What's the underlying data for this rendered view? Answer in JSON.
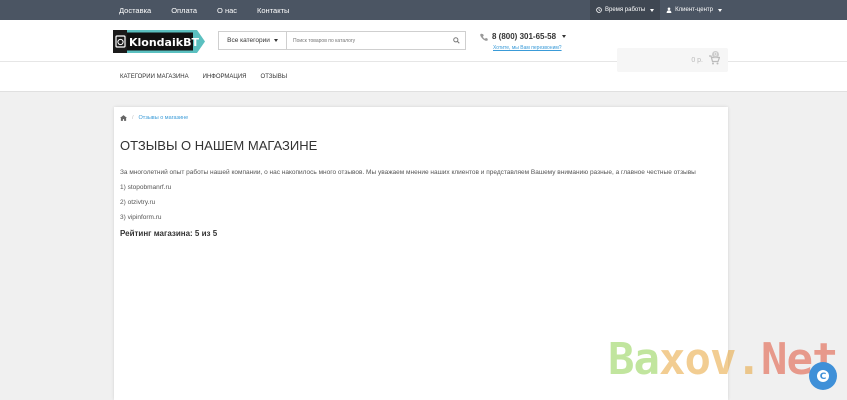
{
  "topbar": {
    "nav": [
      "Доставка",
      "Оплата",
      "О нас",
      "Контакты"
    ],
    "work_hours": "Время работы",
    "client_center": "Клиент-центр"
  },
  "header": {
    "logo_text": "KlondaikBT",
    "category_select": "Все категории",
    "search_placeholder": "Поиск товаров по каталогу",
    "phone": "8 (800) 301-65-58",
    "callback": "Хотите, мы Вам перезвоним?",
    "cart_total": "0 р.",
    "cart_count": "0"
  },
  "menu": [
    "КАТЕГОРИИ МАГАЗИНА",
    "ИНФОРМАЦИЯ",
    "ОТЗЫВЫ"
  ],
  "breadcrumb": {
    "current": "Отзывы о магазине"
  },
  "content": {
    "title": "ОТЗЫВЫ О НАШЕМ МАГАЗИНЕ",
    "intro": "За многолетний опыт работы нашей компании, о нас накопилось много отзывов. Мы уважаем мнение наших клиентов и представляем Вашему вниманию разные, а главное честные отзывы",
    "links": [
      "1) stopobmanrf.ru",
      "2) otzivtry.ru",
      "3) vipinform.ru"
    ],
    "rating": "Рейтинг магазина: 5 из 5"
  },
  "watermark": {
    "text": "Baxov.Net"
  },
  "colors": {
    "topbar": "#4b5563",
    "accent": "#3a9bd8",
    "watermark_green": "#8fd14f",
    "watermark_orange": "#e8a53a",
    "watermark_red": "#e0533a"
  }
}
